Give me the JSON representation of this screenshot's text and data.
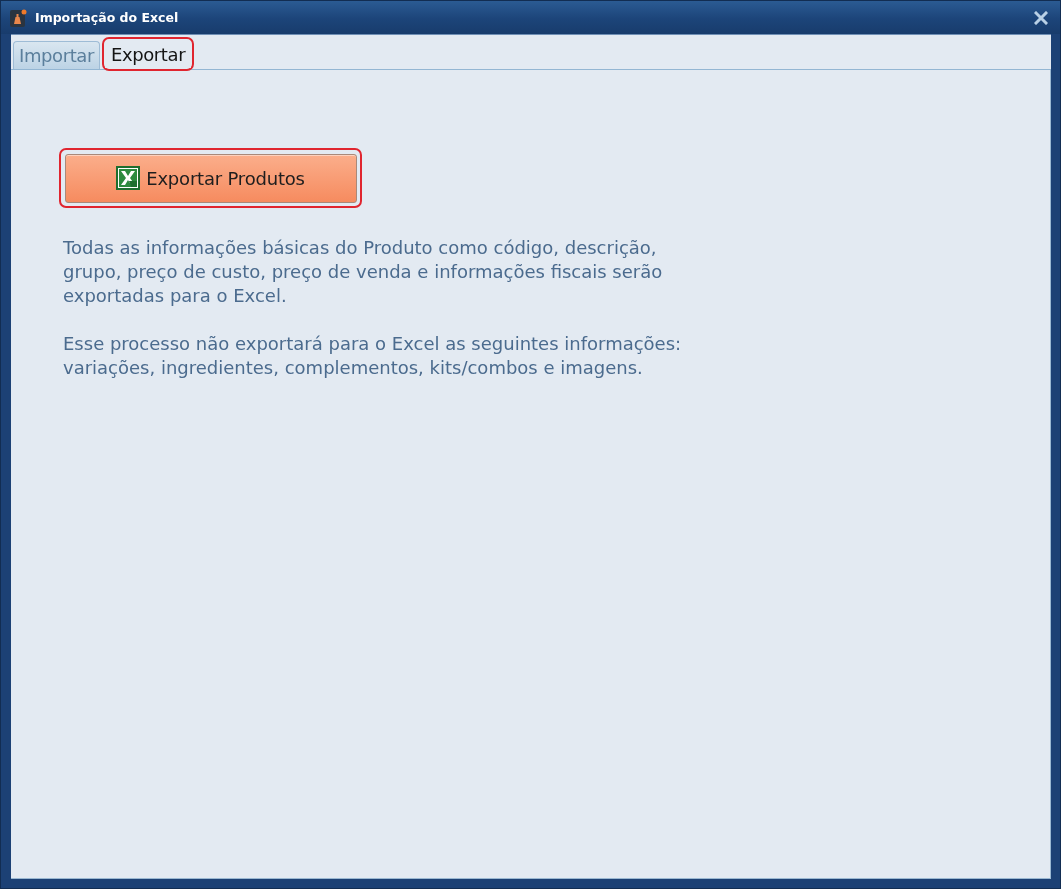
{
  "window": {
    "title": "Importação do Excel"
  },
  "tabs": [
    {
      "label": "Importar",
      "selected": false,
      "highlighted": false
    },
    {
      "label": "Exportar",
      "selected": true,
      "highlighted": true
    }
  ],
  "export_button": {
    "label": "Exportar Produtos",
    "highlighted": true
  },
  "paragraphs": [
    [
      "Todas as informações básicas do Produto como código, descrição,",
      "grupo, preço de custo, preço de venda e informações fiscais serão",
      "exportadas para o Excel."
    ],
    [
      "Esse processo não exportará para o Excel as seguintes informações:",
      "variações, ingredientes, complementos, kits/combos e imagens."
    ]
  ]
}
